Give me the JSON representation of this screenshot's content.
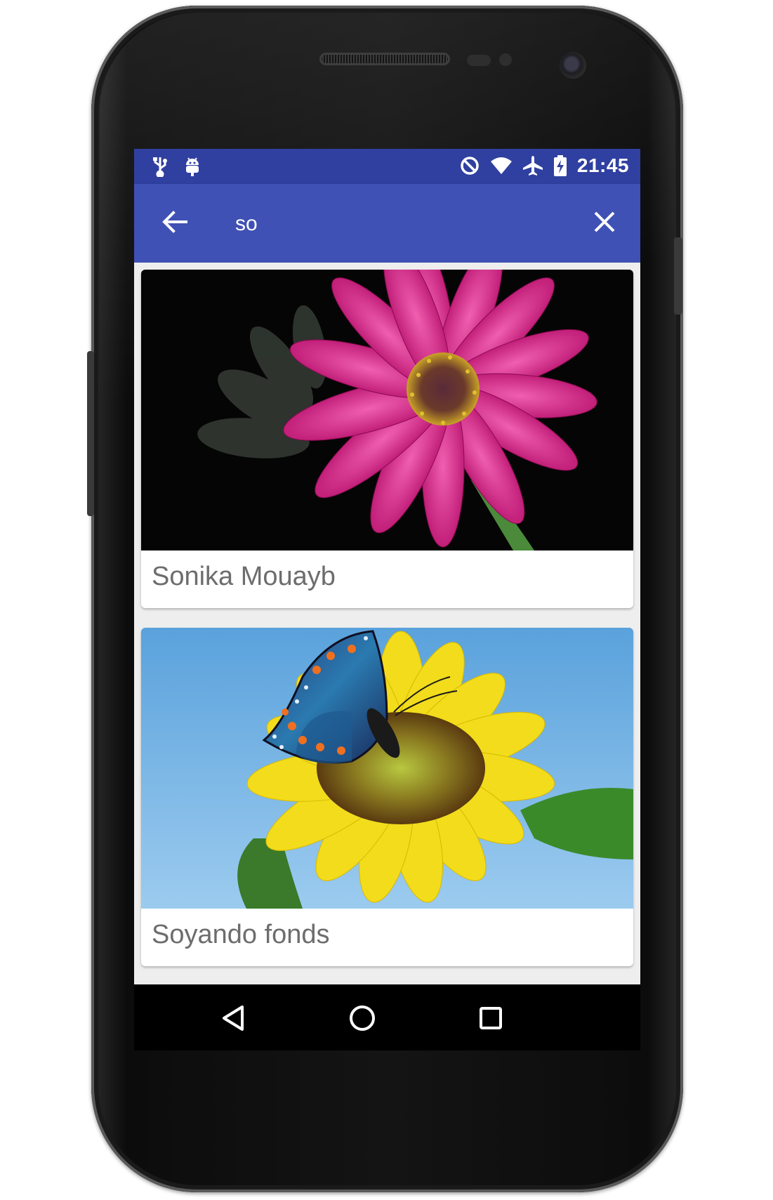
{
  "status_bar": {
    "time": "21:45",
    "left_icons": [
      "usb-icon",
      "android-debug-icon"
    ],
    "right_icons": [
      "do-not-disturb-icon",
      "wifi-icon",
      "airplane-mode-icon",
      "battery-charging-icon"
    ],
    "background": "#3040a0"
  },
  "toolbar": {
    "search_value": "so",
    "background": "#3f51b5",
    "back_icon": "arrow-back-icon",
    "clear_icon": "close-icon"
  },
  "results": [
    {
      "title": "Sonika Mouayb",
      "image": "pink-daisy-flower"
    },
    {
      "title": "Soyando fonds",
      "image": "sunflower-with-butterfly"
    }
  ],
  "nav_bar": {
    "icons": [
      "back-triangle-icon",
      "home-circle-icon",
      "recents-square-icon"
    ]
  }
}
